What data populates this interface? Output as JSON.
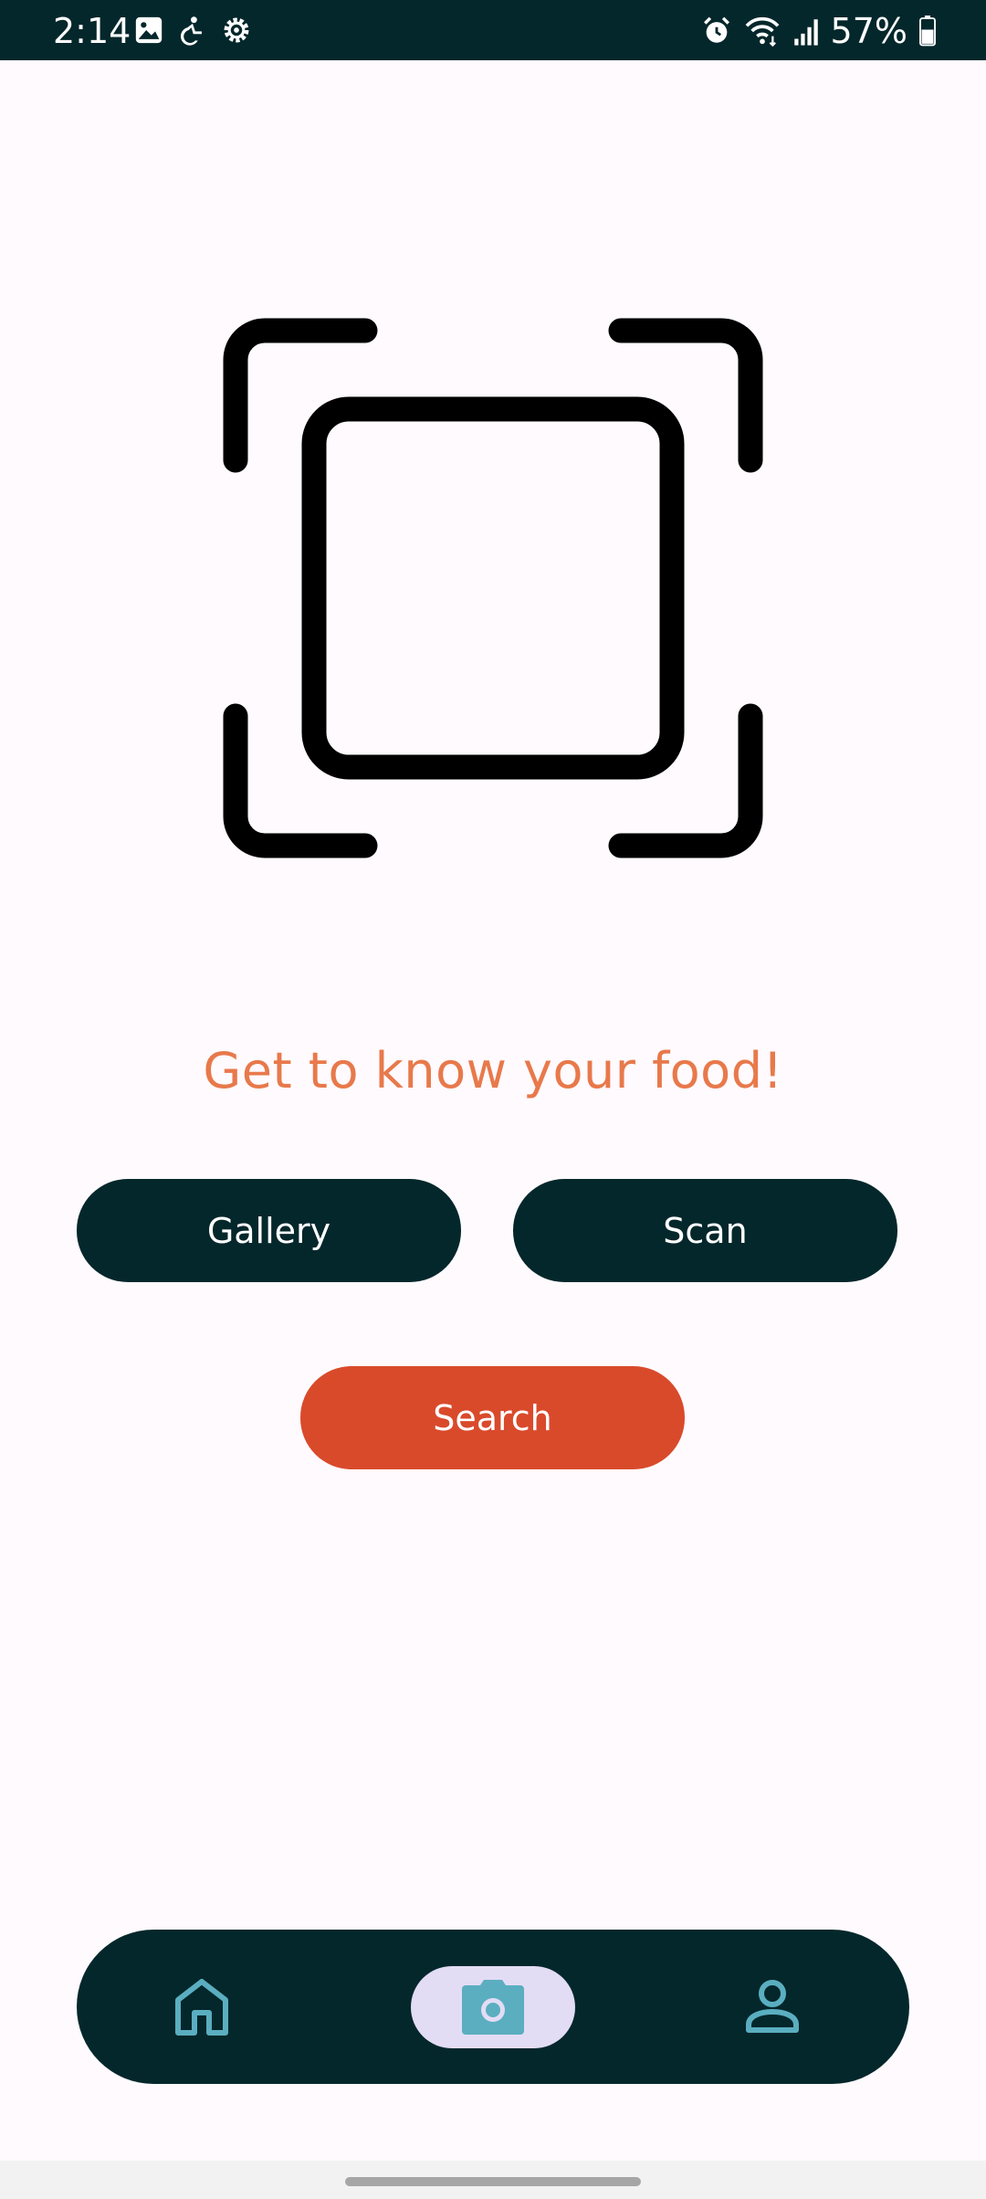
{
  "status_bar": {
    "time": "2:14",
    "left_icons": [
      "image-icon",
      "accessibility-icon",
      "settings-icon"
    ],
    "right_icons": [
      "alarm-icon",
      "wifi-icon",
      "signal-icon",
      "battery-icon"
    ],
    "battery": "57%"
  },
  "main": {
    "illustration_icon": "scan-frame-icon",
    "tagline": "Get to know your food!",
    "gallery_label": "Gallery",
    "scan_label": "Scan",
    "search_label": "Search"
  },
  "bottom_nav": {
    "items": [
      {
        "icon": "home-icon",
        "selected": false
      },
      {
        "icon": "camera-icon",
        "selected": true
      },
      {
        "icon": "profile-icon",
        "selected": false
      }
    ]
  },
  "colors": {
    "dark_teal": "#04272b",
    "accent_orange": "#e8794b",
    "search_red": "#d94a2b",
    "nav_icon": "#5aaec0",
    "nav_selected_bg": "#e3dcf5",
    "background": "#fefafd"
  }
}
